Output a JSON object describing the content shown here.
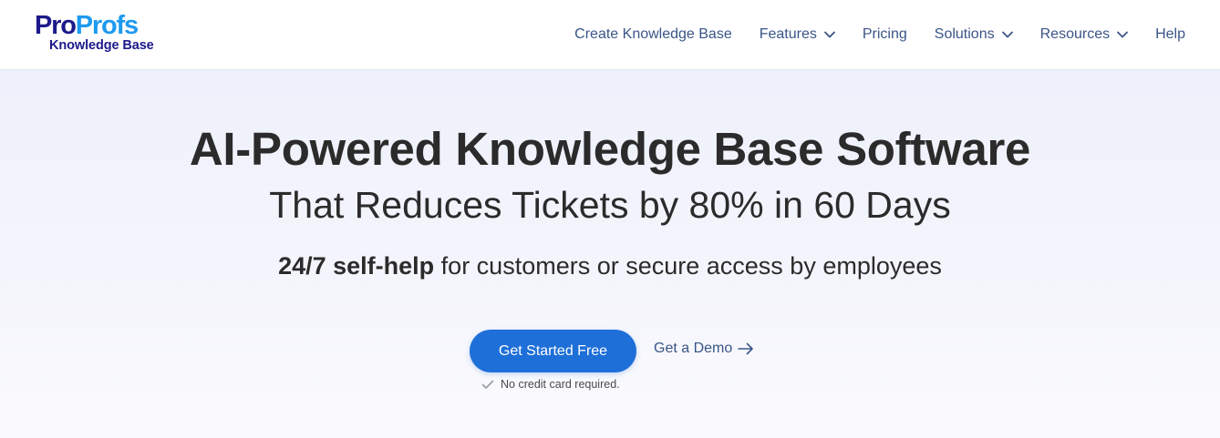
{
  "logo": {
    "brand_part1": "Pro",
    "brand_part2": "Profs",
    "product": "Knowledge Base",
    "colors": {
      "dark": "#1c1a8a",
      "light": "#1e9af0"
    }
  },
  "nav": {
    "items": [
      {
        "label": "Create Knowledge Base",
        "dropdown": false
      },
      {
        "label": "Features",
        "dropdown": true
      },
      {
        "label": "Pricing",
        "dropdown": false
      },
      {
        "label": "Solutions",
        "dropdown": true
      },
      {
        "label": "Resources",
        "dropdown": true
      },
      {
        "label": "Help",
        "dropdown": false
      }
    ],
    "icons": {
      "dropdown": "chevron-down-icon"
    }
  },
  "hero": {
    "headline": "AI-Powered Knowledge Base Software",
    "subheadline": "That Reduces Tickets by 80% in 60 Days",
    "tagline_bold": "24/7 self-help",
    "tagline_rest": " for customers or secure access by employees",
    "cta_primary": "Get Started Free",
    "cta_secondary": "Get a Demo",
    "cta_secondary_icon": "arrow-right-icon",
    "note": "No credit card required.",
    "note_icon": "check-icon"
  },
  "colors": {
    "accent": "#1e6fd8",
    "nav_text": "#3a5587",
    "heading": "#2b2b2b"
  }
}
